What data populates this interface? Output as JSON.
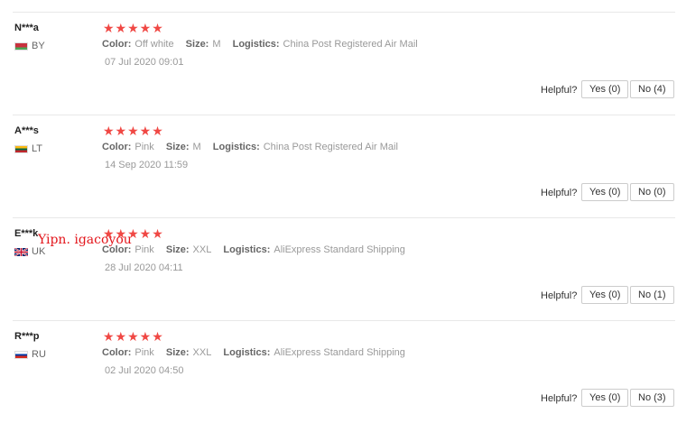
{
  "reviews": [
    {
      "user": "N***a",
      "country": "BY",
      "flag_colors": [
        "#c8313e",
        "#4aa657"
      ],
      "stars": "★★★★★",
      "color_label": "Color:",
      "color_value": "Off white",
      "size_label": "Size:",
      "size_value": "M",
      "logistics_label": "Logistics:",
      "logistics_value": "China Post Registered Air Mail",
      "date": "07 Jul 2020 09:01",
      "helpful_label": "Helpful?",
      "yes_label": "Yes (0)",
      "no_label": "No (4)"
    },
    {
      "user": "A***s",
      "country": "LT",
      "flag_colors": [
        "#fdb913",
        "#006a44",
        "#c1272d"
      ],
      "stars": "★★★★★",
      "color_label": "Color:",
      "color_value": "Pink",
      "size_label": "Size:",
      "size_value": "M",
      "logistics_label": "Logistics:",
      "logistics_value": "China Post Registered Air Mail",
      "date": "14 Sep 2020 11:59",
      "helpful_label": "Helpful?",
      "yes_label": "Yes (0)",
      "no_label": "No (0)"
    },
    {
      "user": "E***k",
      "country": "UK",
      "flag_colors": [
        "#012169",
        "#ffffff",
        "#c8102e"
      ],
      "stars": "★★★★★",
      "color_label": "Color:",
      "color_value": "Pink",
      "size_label": "Size:",
      "size_value": "XXL",
      "logistics_label": "Logistics:",
      "logistics_value": "AliExpress Standard Shipping",
      "date": "28 Jul 2020 04:11",
      "helpful_label": "Helpful?",
      "yes_label": "Yes (0)",
      "no_label": "No (1)"
    },
    {
      "user": "R***p",
      "country": "RU",
      "flag_colors": [
        "#ffffff",
        "#0039a6",
        "#d52b1e"
      ],
      "stars": "★★★★★",
      "color_label": "Color:",
      "color_value": "Pink",
      "size_label": "Size:",
      "size_value": "XXL",
      "logistics_label": "Logistics:",
      "logistics_value": "AliExpress Standard Shipping",
      "date": "02 Jul 2020 04:50",
      "helpful_label": "Helpful?",
      "yes_label": "Yes (0)",
      "no_label": "No (3)"
    }
  ],
  "watermark": "Yipn. igacoyou",
  "colors": {
    "star": "#f04844",
    "watermark": "#e3161c"
  }
}
